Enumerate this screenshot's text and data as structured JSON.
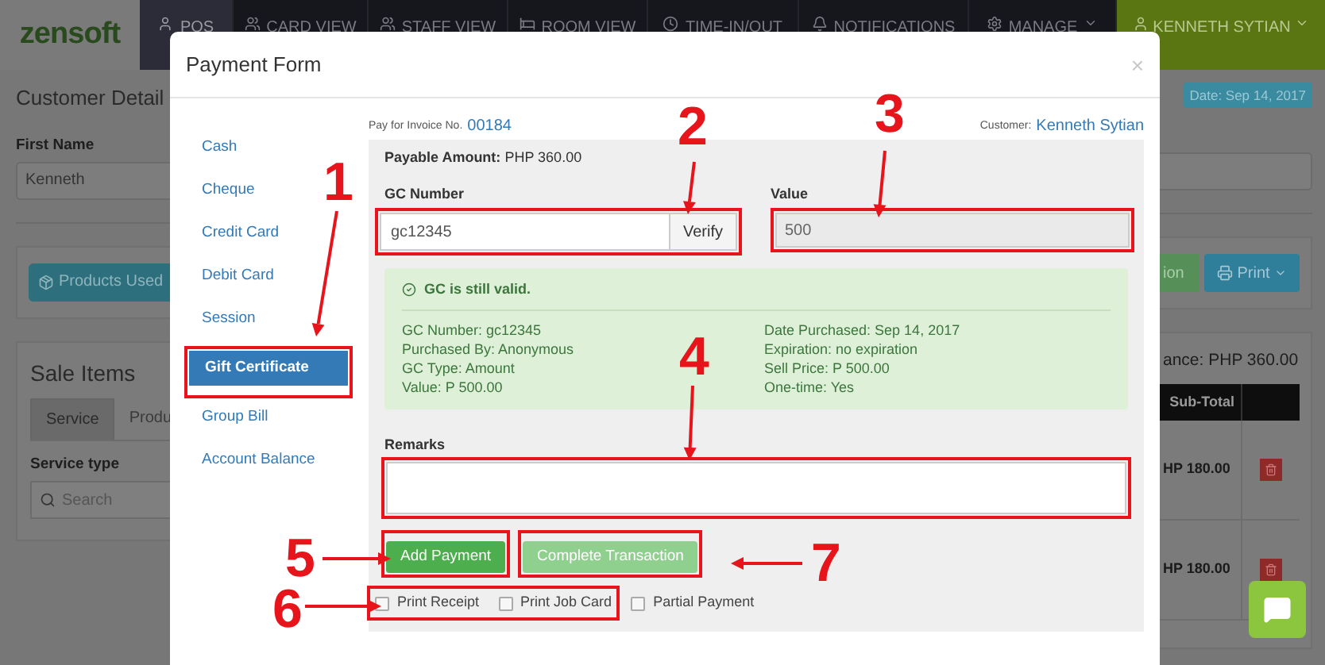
{
  "navbar": {
    "logo": "zensoft",
    "items": [
      {
        "label": "POS",
        "selected": true,
        "dropdown": false
      },
      {
        "label": "CARD VIEW",
        "selected": false,
        "dropdown": false
      },
      {
        "label": "STAFF VIEW",
        "selected": false,
        "dropdown": false
      },
      {
        "label": "ROOM VIEW",
        "selected": false,
        "dropdown": false
      },
      {
        "label": "TIME-IN/OUT",
        "selected": false,
        "dropdown": false
      },
      {
        "label": "NOTIFICATIONS",
        "selected": false,
        "dropdown": false
      },
      {
        "label": "MANAGE",
        "selected": false,
        "dropdown": true
      }
    ],
    "user": {
      "label": "KENNETH SYTIAN",
      "dropdown": true
    }
  },
  "page": {
    "heading": "Customer Detail",
    "date_badge": "Date: Sep 14, 2017",
    "first_name_label": "First Name",
    "first_name_value": "Kenneth",
    "products_button": "Products Used",
    "green_button": "ion",
    "print_button": "Print",
    "sale_items_title": "Sale Items",
    "balance": "ance: PHP 360.00",
    "tabs": [
      {
        "label": "Service",
        "selected": true
      },
      {
        "label": "Produ",
        "selected": false
      }
    ],
    "service_type_label": "Service type",
    "search_placeholder": "Search",
    "table_header": "Sub-Total",
    "rows": [
      {
        "subtotal": "HP 180.00"
      },
      {
        "subtotal": "HP 180.00"
      }
    ]
  },
  "modal": {
    "title": "Payment Form",
    "close": "×",
    "methods": [
      {
        "label": "Cash",
        "selected": false,
        "highlighted": false
      },
      {
        "label": "Cheque",
        "selected": false,
        "highlighted": false
      },
      {
        "label": "Credit Card",
        "selected": false,
        "highlighted": false
      },
      {
        "label": "Debit Card",
        "selected": false,
        "highlighted": false
      },
      {
        "label": "Session",
        "selected": false,
        "highlighted": false
      },
      {
        "label": "Gift Certificate",
        "selected": true,
        "highlighted": true
      },
      {
        "label": "Group Bill",
        "selected": false,
        "highlighted": false
      },
      {
        "label": "Account Balance",
        "selected": false,
        "highlighted": false
      }
    ],
    "invoice_label": "Pay for Invoice No.",
    "invoice_number": "00184",
    "customer_label": "Customer:",
    "customer_name": "Kenneth Sytian",
    "payable_label": "Payable Amount:",
    "payable_value": "PHP 360.00",
    "gc_number": {
      "label": "GC Number",
      "value": "gc12345",
      "button": "Verify",
      "highlighted": true
    },
    "value_field": {
      "label": "Value",
      "value": "500",
      "disabled": true,
      "highlighted": true
    },
    "alert": {
      "title": "GC is still valid.",
      "left": [
        "GC Number: gc12345",
        "Purchased By: Anonymous",
        "GC Type: Amount",
        "Value: P 500.00"
      ],
      "right": [
        "Date Purchased: Sep 14, 2017",
        "Expiration: no expiration",
        "Sell Price: P 500.00",
        "One-time: Yes"
      ]
    },
    "remarks": {
      "label": "Remarks",
      "highlighted": true
    },
    "buttons": [
      {
        "label": "Add Payment",
        "disabled": false,
        "highlighted": true
      },
      {
        "label": "Complete Transaction",
        "disabled": true,
        "highlighted": true
      }
    ],
    "checkboxes": [
      {
        "label": "Print Receipt",
        "checked": false,
        "highlighted": true
      },
      {
        "label": "Print Job Card",
        "checked": false,
        "highlighted": true
      },
      {
        "label": "Partial Payment",
        "checked": false,
        "highlighted": false
      }
    ]
  },
  "annotations": [
    {
      "number": "1"
    },
    {
      "number": "2"
    },
    {
      "number": "3"
    },
    {
      "number": "4"
    },
    {
      "number": "5"
    },
    {
      "number": "6"
    },
    {
      "number": "7"
    }
  ]
}
